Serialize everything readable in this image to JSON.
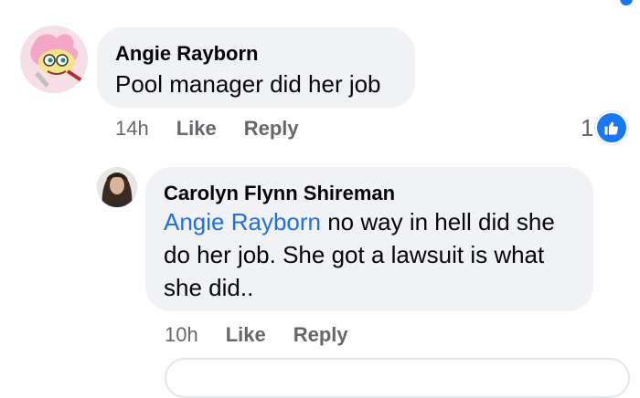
{
  "comment1": {
    "author": "Angie Rayborn",
    "text": "Pool manager did her job",
    "time": "14h",
    "like_label": "Like",
    "reply_label": "Reply",
    "reaction_count": "1"
  },
  "comment2": {
    "author": "Carolyn Flynn Shireman",
    "mention": "Angie Rayborn",
    "text_line1_rest": " no way in hell did she",
    "text_line2": "do her job. She got a lawsuit is what",
    "text_line3": "she did..",
    "time": "10h",
    "like_label": "Like",
    "reply_label": "Reply"
  },
  "colors": {
    "bubble": "#f0f2f5",
    "mention": "#216fdb",
    "secondary_text": "#65676b",
    "like_blue": "#1877f2"
  },
  "icons": {
    "reaction": "thumbs-up-icon"
  }
}
